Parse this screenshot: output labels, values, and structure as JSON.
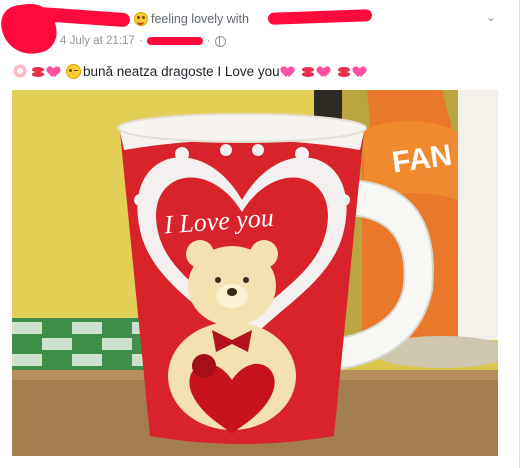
{
  "post": {
    "header": {
      "feeling_text": "feeling lovely with",
      "feeling_emoji": "smiling-face-icon"
    },
    "meta": {
      "timestamp": "4 July at 21:17",
      "separator": "·",
      "privacy_icon": "globe-icon"
    },
    "options_icon": "chevron-down-icon",
    "status": {
      "message": "bună neatza dragoste I Love you",
      "emojis_before": [
        "blossom-icon",
        "kiss-mark-icon",
        "heart-icon",
        "winking-kiss-face-icon"
      ],
      "emojis_after": [
        "heart-icon",
        "kiss-mark-icon",
        "heart-icon",
        "kiss-mark-icon",
        "heart-icon"
      ]
    },
    "photo": {
      "mug_text": "I Love you",
      "bottle_text": "FAN"
    }
  }
}
